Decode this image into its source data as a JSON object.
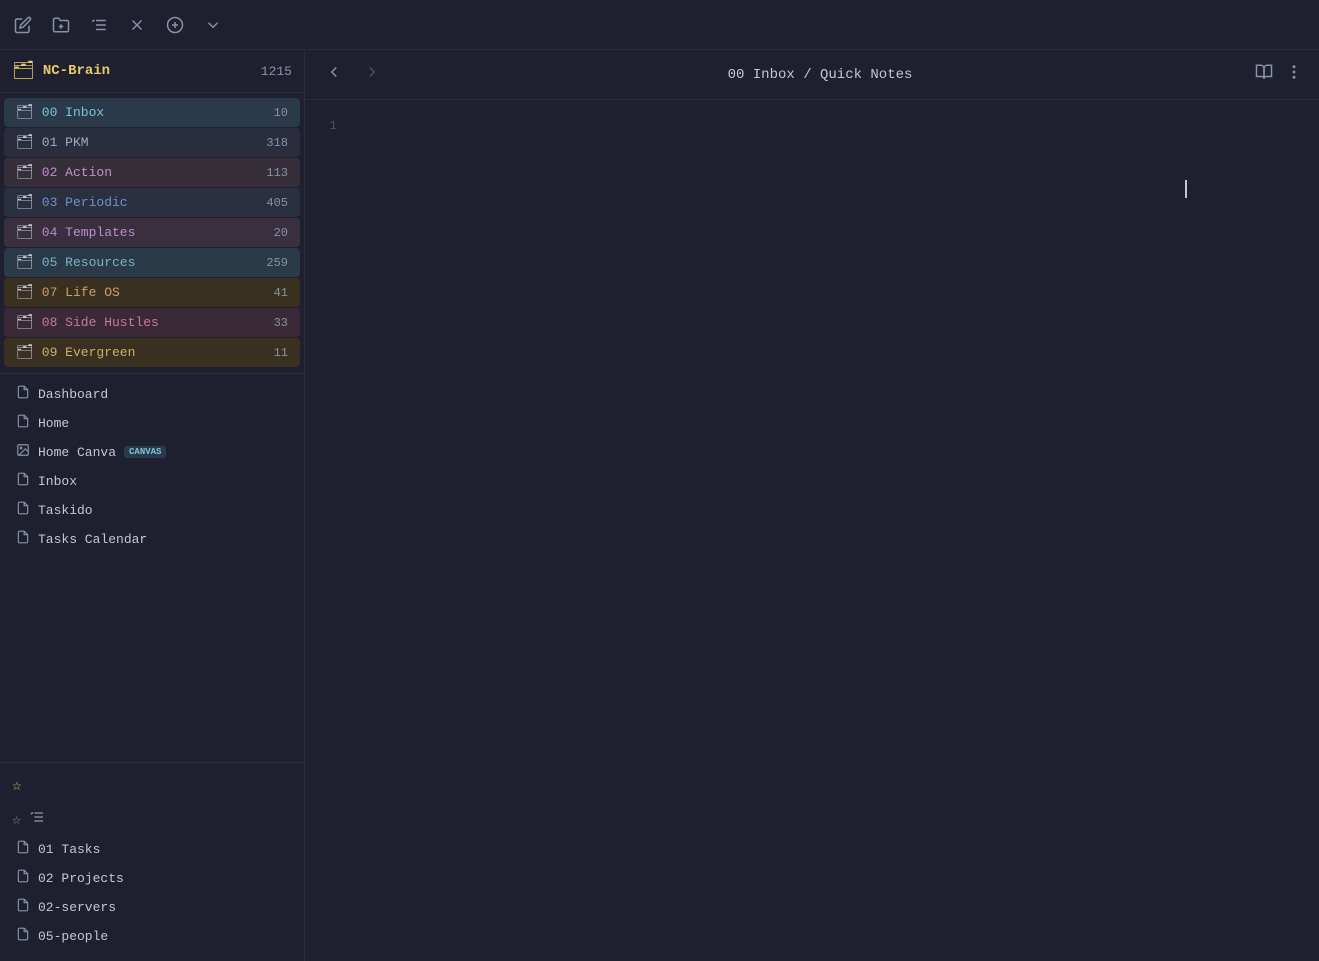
{
  "toolbar": {
    "icons": [
      {
        "name": "edit-icon",
        "symbol": "✎"
      },
      {
        "name": "folder-open-icon",
        "symbol": "🗁"
      },
      {
        "name": "sort-icon",
        "symbol": "⇅"
      },
      {
        "name": "close-icon",
        "symbol": "✕"
      },
      {
        "name": "add-circle-icon",
        "symbol": "⊕"
      },
      {
        "name": "chevron-down-icon",
        "symbol": "⌄"
      }
    ]
  },
  "vault": {
    "name": "NC-Brain",
    "count": "1215"
  },
  "folders": [
    {
      "id": "00",
      "name": "00 Inbox",
      "count": "10",
      "colorClass": "folder-00"
    },
    {
      "id": "01",
      "name": "01 PKM",
      "count": "318",
      "colorClass": "folder-01"
    },
    {
      "id": "02",
      "name": "02 Action",
      "count": "113",
      "colorClass": "folder-02"
    },
    {
      "id": "03",
      "name": "03 Periodic",
      "count": "405",
      "colorClass": "folder-03"
    },
    {
      "id": "04",
      "name": "04 Templates",
      "count": "20",
      "colorClass": "folder-04"
    },
    {
      "id": "05",
      "name": "05 Resources",
      "count": "259",
      "colorClass": "folder-05"
    },
    {
      "id": "07",
      "name": "07 Life OS",
      "count": "41",
      "colorClass": "folder-07"
    },
    {
      "id": "08",
      "name": "08 Side Hustles",
      "count": "33",
      "colorClass": "folder-08"
    },
    {
      "id": "09",
      "name": "09 Evergreen",
      "count": "11",
      "colorClass": "folder-09"
    }
  ],
  "files": [
    {
      "name": "Dashboard",
      "type": "note",
      "canvas": false
    },
    {
      "name": "Home",
      "type": "note",
      "canvas": false
    },
    {
      "name": "Home Canva",
      "type": "note",
      "canvas": true
    },
    {
      "name": "Inbox",
      "type": "note",
      "canvas": false
    },
    {
      "name": "Taskido",
      "type": "note",
      "canvas": false
    },
    {
      "name": "Tasks Calendar",
      "type": "note",
      "canvas": false
    }
  ],
  "bookmarks": {
    "items": [
      {
        "name": "01 Tasks",
        "type": "note"
      },
      {
        "name": "02 Projects",
        "type": "note"
      },
      {
        "name": "02-servers",
        "type": "note"
      },
      {
        "name": "05-people",
        "type": "note"
      }
    ]
  },
  "editor": {
    "title": "00 Inbox / Quick Notes",
    "line_number": "1",
    "canvas_badge": "CANVAS"
  }
}
